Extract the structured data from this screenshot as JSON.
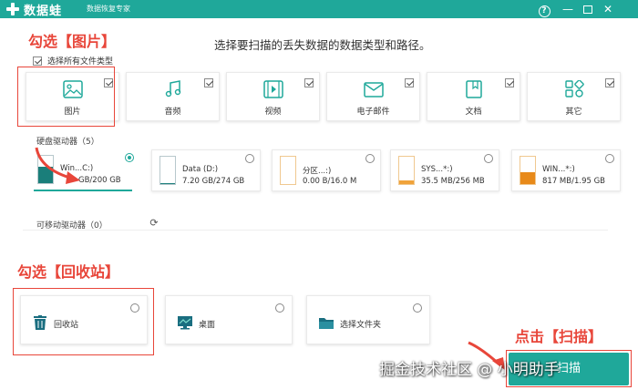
{
  "titlebar": {
    "app_name": "数据蛙",
    "subtitle": "数据恢复专家",
    "accent_color": "#1fa89a"
  },
  "headline": "选择要扫描的丢失数据的数据类型和路径。",
  "select_all": {
    "label": "选择所有文件类型",
    "checked": true
  },
  "file_types": [
    {
      "label": "图片",
      "icon": "image-icon",
      "checked": true
    },
    {
      "label": "音频",
      "icon": "music-icon",
      "checked": true
    },
    {
      "label": "视频",
      "icon": "video-icon",
      "checked": true
    },
    {
      "label": "电子邮件",
      "icon": "email-icon",
      "checked": true
    },
    {
      "label": "文档",
      "icon": "document-icon",
      "checked": true
    },
    {
      "label": "其它",
      "icon": "other-icon",
      "checked": true
    }
  ],
  "hard_drives": {
    "title": "硬盘驱动器（5）",
    "drives": [
      {
        "name": "Win...C:)",
        "size": "GB/200 GB",
        "selected": true,
        "usage": 0.6,
        "fill_color": "#1a7e7a"
      },
      {
        "name": "Data (D:)",
        "size": "7.20 GB/274 GB",
        "selected": false,
        "usage": 0.03,
        "fill_color": "#1a7e7a"
      },
      {
        "name": "分区...:)",
        "size": "0.00  B/16.0 M",
        "selected": false,
        "usage": 0.0,
        "fill_color": "#f0a33a"
      },
      {
        "name": "SYS...*:)",
        "size": "35.5 MB/256 MB",
        "selected": false,
        "usage": 0.14,
        "fill_color": "#f0a33a"
      },
      {
        "name": "WIN...*:)",
        "size": "817 MB/1.95 GB",
        "selected": false,
        "usage": 0.42,
        "fill_color": "#e88a1a"
      }
    ]
  },
  "removable": {
    "title": "可移动驱动器（0）"
  },
  "locations": [
    {
      "label": "回收站",
      "icon": "trash-icon"
    },
    {
      "label": "桌面",
      "icon": "desktop-icon"
    },
    {
      "label": "选择文件夹",
      "icon": "folder-icon"
    }
  ],
  "scan_button": {
    "label": "扫描"
  },
  "annotations": {
    "pick_images": "勾选【图片】",
    "pick_recycle": "勾选【回收站】",
    "click_scan": "点击【扫描】",
    "color": "#e8463a"
  },
  "watermark": "掘金技术社区 @ 小明助手"
}
